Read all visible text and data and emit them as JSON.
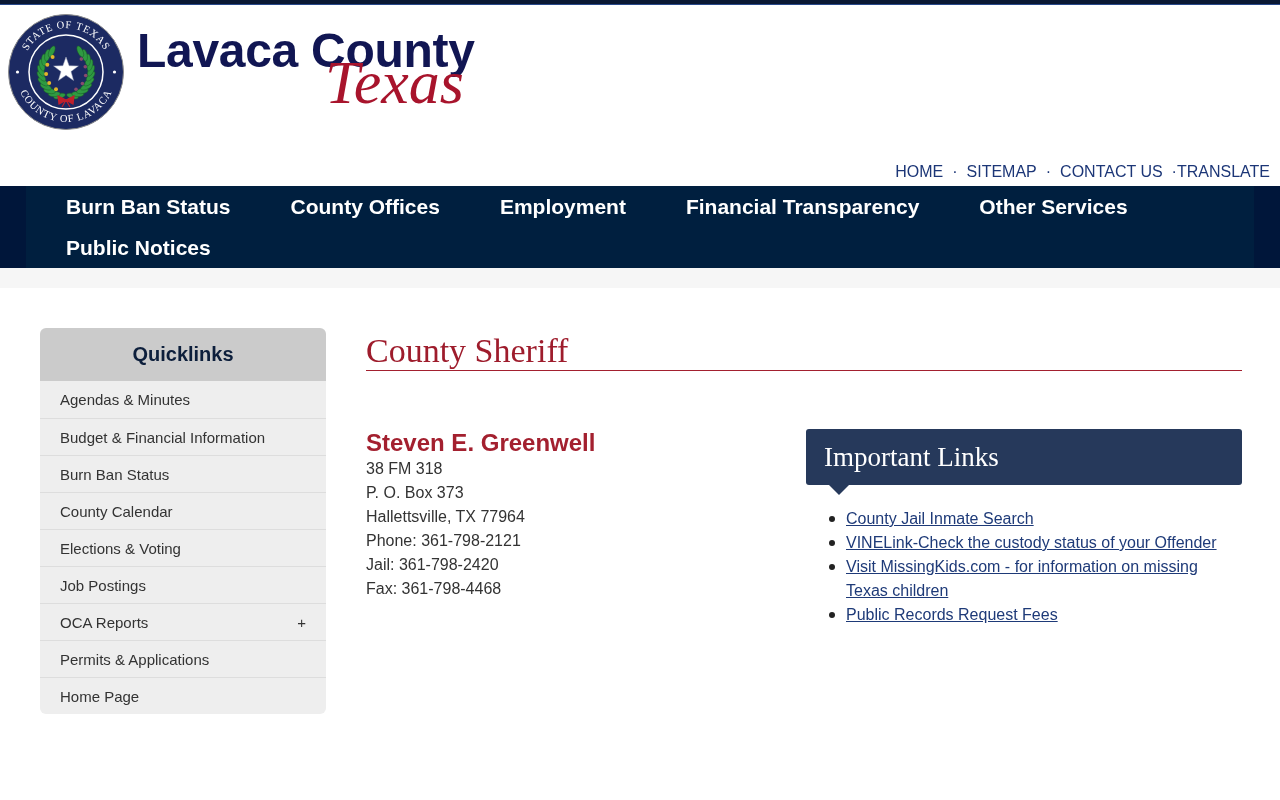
{
  "header": {
    "seal": {
      "top_text": "STATE OF TEXAS",
      "bottom_text": "COUNTY OF LAVACA"
    },
    "title": "Lavaca County",
    "subtitle": "Texas"
  },
  "utility_nav": [
    {
      "label": "HOME"
    },
    {
      "separator": "·",
      "label": "SITEMAP"
    },
    {
      "separator": "·",
      "label": "CONTACT US"
    },
    {
      "label": "·TRANSLATE"
    }
  ],
  "main_nav": [
    {
      "label": "Burn Ban Status"
    },
    {
      "label": "County Offices"
    },
    {
      "label": "Employment"
    },
    {
      "label": "Financial Transparency"
    },
    {
      "label": "Other Services"
    },
    {
      "label": "Public Notices"
    }
  ],
  "sidebar": {
    "title": "Quicklinks",
    "items": [
      {
        "label": "Agendas & Minutes"
      },
      {
        "label": "Budget & Financial Information"
      },
      {
        "label": "Burn Ban Status"
      },
      {
        "label": "County Calendar"
      },
      {
        "label": "Elections & Voting"
      },
      {
        "label": "Job Postings"
      },
      {
        "label": "OCA Reports",
        "toggle": "+"
      },
      {
        "label": "Permits & Applications"
      },
      {
        "label": "Home Page"
      }
    ]
  },
  "page": {
    "title": "County Sheriff",
    "contact": {
      "name": "Steven E. Greenwell",
      "lines": [
        "38 FM 318",
        "P. O. Box 373",
        "Hallettsville, TX 77964",
        "Phone: 361-798-2121",
        "Jail: 361-798-2420",
        "Fax: 361-798-4468"
      ]
    },
    "links_panel": {
      "title": "Important Links",
      "links": [
        "County Jail Inmate Search",
        "VINELink-Check the custody status of your Offender",
        "Visit MissingKids.com - for information on missing Texas children",
        "Public Records Request Fees"
      ]
    }
  }
}
